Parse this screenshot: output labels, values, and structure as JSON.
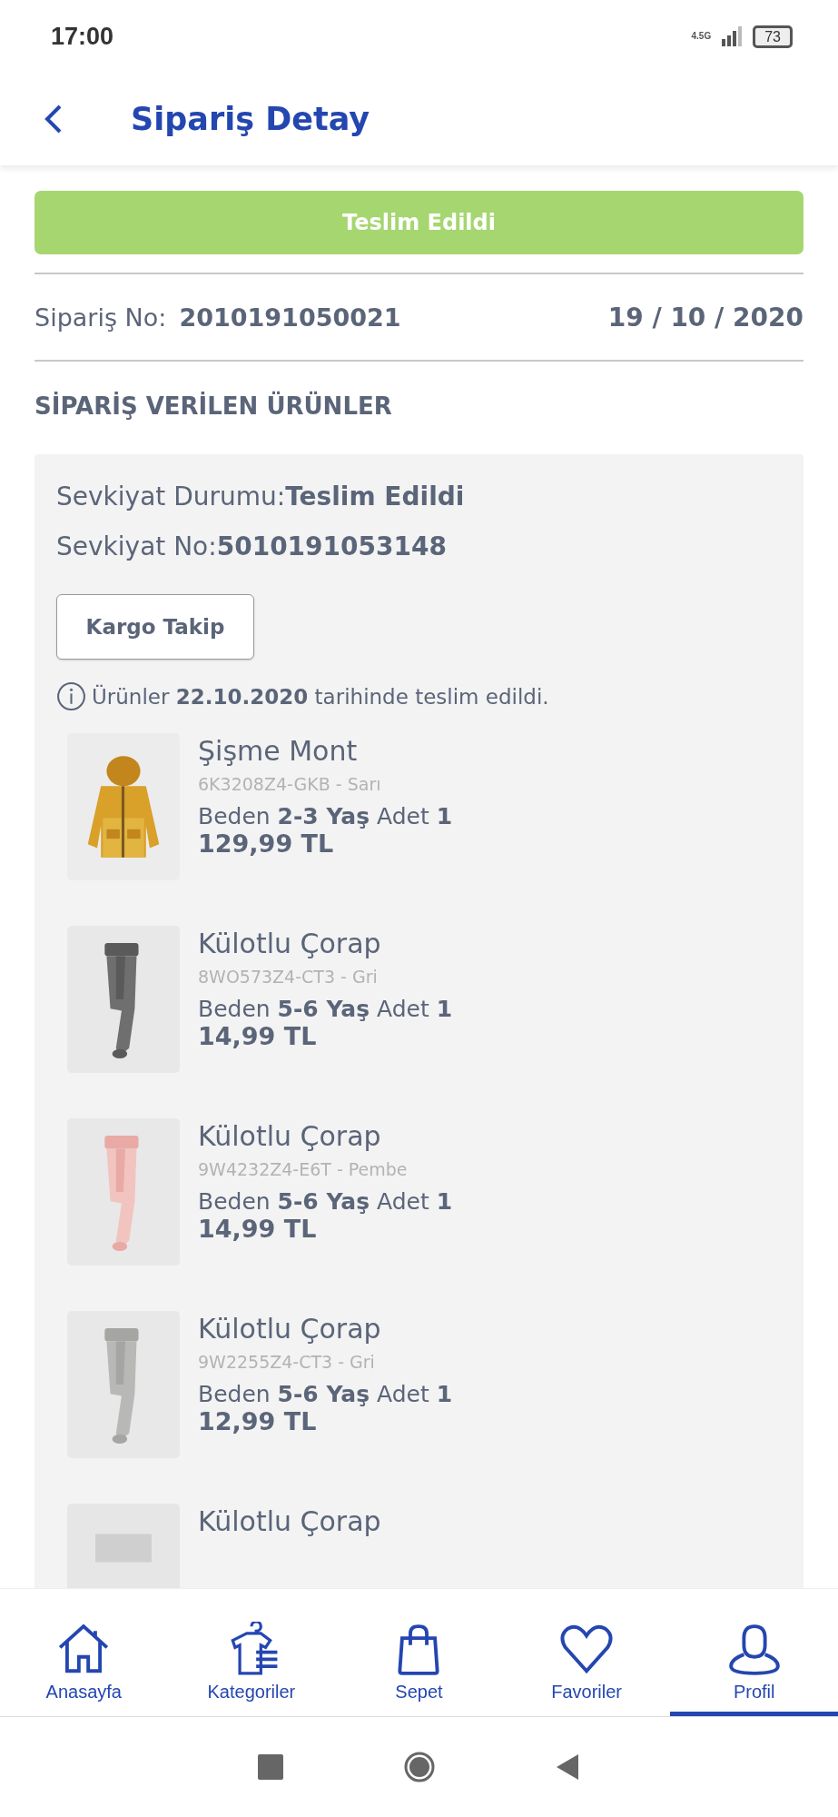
{
  "status_bar": {
    "time": "17:00",
    "network": "4.5G",
    "battery": "73"
  },
  "header": {
    "title": "Sipariş Detay"
  },
  "order": {
    "status": "Teslim Edildi",
    "number_label": "Sipariş No:",
    "number": "2010191050021",
    "date": "19 / 10 / 2020"
  },
  "section_title": "SİPARİŞ VERİLEN ÜRÜNLER",
  "shipment": {
    "status_line": "Sevkiyat Durumu:**Teslim Edildi**",
    "number_line": "Sevkiyat No:**5010191053148**",
    "track_button": "Kargo Takip",
    "info": "Ürünler **22.10.2020** tarihinde teslim edildi.",
    "products": [
      {
        "name": "Şişme Mont",
        "code": "6K3208Z4-GKB - Sarı",
        "details": "Beden **2-3 Yaş** Adet **1**",
        "price": "129,99 TL"
      },
      {
        "name": "Külotlu Çorap",
        "code": "8WO573Z4-CT3 - Gri",
        "details": "Beden **5-6 Yaş** Adet **1**",
        "price": "14,99 TL"
      },
      {
        "name": "Külotlu Çorap",
        "code": "9W4232Z4-E6T - Pembe",
        "details": "Beden **5-6 Yaş** Adet **1**",
        "price": "14,99 TL"
      },
      {
        "name": "Külotlu Çorap",
        "code": "9W2255Z4-CT3 - Gri",
        "details": "Beden **5-6 Yaş** Adet **1**",
        "price": "12,99 TL"
      },
      {
        "name": "Külotlu Çorap"
      }
    ]
  },
  "bottom_nav": [
    {
      "label": "Anasayfa",
      "selected": false
    },
    {
      "label": "Kategoriler",
      "selected": false
    },
    {
      "label": "Sepet",
      "selected": false
    },
    {
      "label": "Favoriler",
      "selected": false
    },
    {
      "label": "Profil",
      "selected": true
    }
  ]
}
